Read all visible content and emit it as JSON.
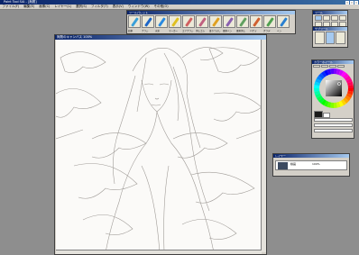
{
  "window": {
    "title": "Paint Tool SAI - [無題]"
  },
  "menu": [
    "ファイル(F)",
    "編集(E)",
    "画像(C)",
    "レイヤー(L)",
    "選択(S)",
    "フィルタ(T)",
    "表示(V)",
    "ウィンドウ(W)",
    "その他(O)"
  ],
  "tool_palette": {
    "title": "ツールパレット",
    "tools": [
      {
        "label": "鉛筆",
        "color": "#3aa0d8"
      },
      {
        "label": "ブラシ",
        "color": "#1e66c8"
      },
      {
        "label": "水彩",
        "color": "#2a8ae0"
      },
      {
        "label": "マーカー",
        "color": "#e0c020"
      },
      {
        "label": "エアブラシ",
        "color": "#d06060"
      },
      {
        "label": "消しゴム",
        "color": "#c06080"
      },
      {
        "label": "塗りつぶし",
        "color": "#e0a020"
      },
      {
        "label": "選択ペン",
        "color": "#8a60b0"
      },
      {
        "label": "選択消し",
        "color": "#60a060"
      },
      {
        "label": "バケツ",
        "color": "#d06030"
      },
      {
        "label": "グラデ",
        "color": "#50a050"
      },
      {
        "label": "ペン",
        "color": "#2a80d0"
      }
    ]
  },
  "tool_panel": {
    "title": "ツール"
  },
  "subtool_panel": {
    "title": "サブツール"
  },
  "canvas": {
    "title": "無題のキャンバス 100%"
  },
  "color_panel": {
    "title": "カラーホイール",
    "hue_ring": [
      "#ff0000",
      "#ffff00",
      "#00ff00",
      "#00ffff",
      "#0000ff",
      "#ff00ff",
      "#ff0000"
    ]
  },
  "layer_panel": {
    "title": "レイヤー",
    "layer_name": "線画",
    "opacity": "100%"
  }
}
